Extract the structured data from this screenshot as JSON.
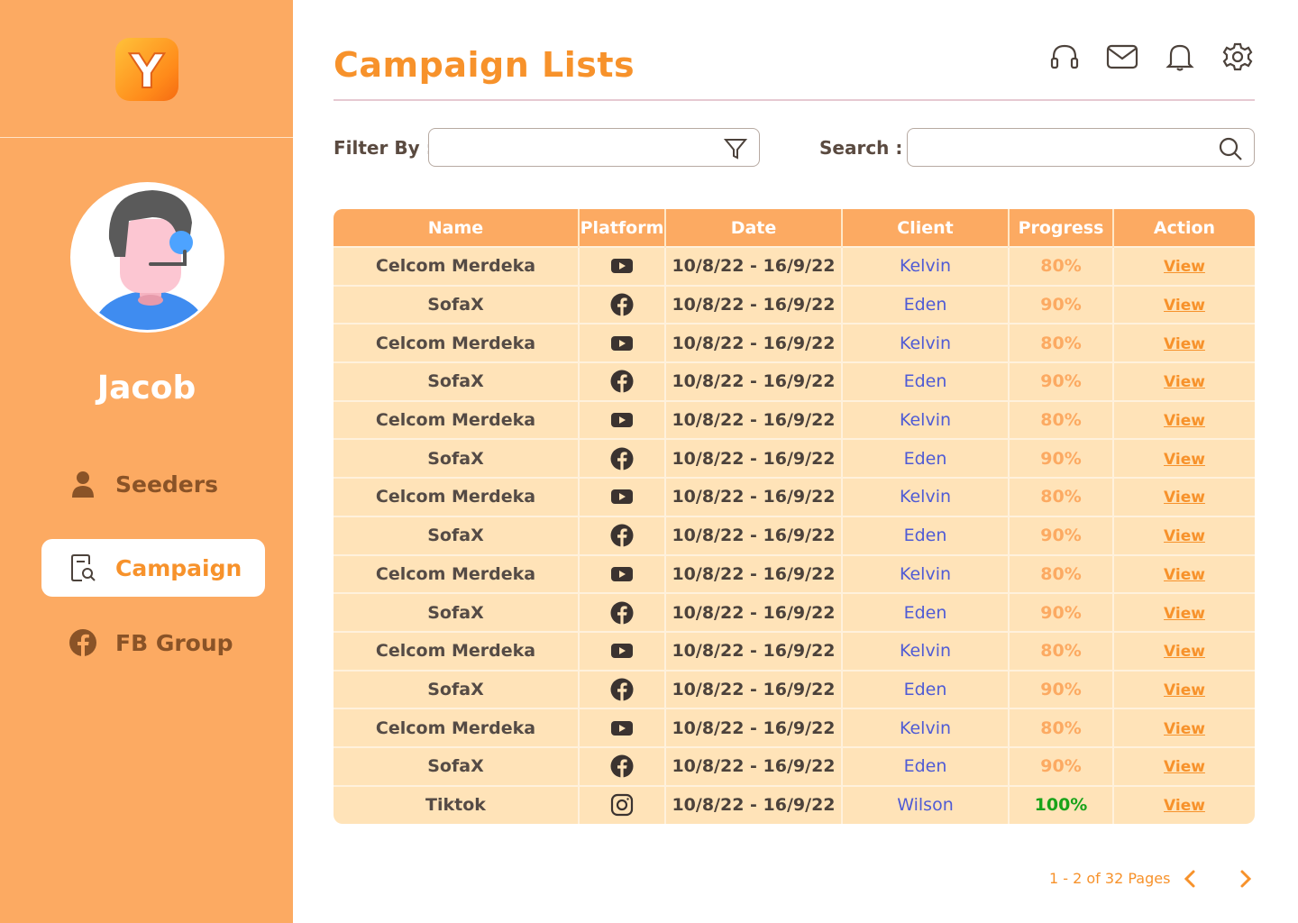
{
  "app": {
    "logo_letter": "Y",
    "accent_color": "#F7922B",
    "sidebar_color": "#FCAA62"
  },
  "sidebar": {
    "user_name": "Jacob",
    "items": [
      {
        "label": "Seeders",
        "icon": "user-icon",
        "active": false
      },
      {
        "label": "Campaign",
        "icon": "campaign-search-icon",
        "active": true
      },
      {
        "label": "FB Group",
        "icon": "facebook-icon",
        "active": false
      }
    ]
  },
  "header": {
    "title": "Campaign Lists",
    "icons": [
      "headset-icon",
      "mail-icon",
      "bell-icon",
      "gear-icon"
    ]
  },
  "filters": {
    "filter_label": "Filter By :",
    "filter_value": "",
    "search_label": "Search :",
    "search_value": ""
  },
  "table": {
    "columns": [
      "Name",
      "Platform",
      "Date",
      "Client",
      "Progress",
      "Action"
    ],
    "rows": [
      {
        "name": "Celcom Merdeka",
        "platform": "youtube-icon",
        "date": "10/8/22 - 16/9/22",
        "client": "Kelvin",
        "progress": "80%",
        "action": "View"
      },
      {
        "name": "SofaX",
        "platform": "facebook-icon",
        "date": "10/8/22 - 16/9/22",
        "client": "Eden",
        "progress": "90%",
        "action": "View"
      },
      {
        "name": "Celcom Merdeka",
        "platform": "youtube-icon",
        "date": "10/8/22 - 16/9/22",
        "client": "Kelvin",
        "progress": "80%",
        "action": "View"
      },
      {
        "name": "SofaX",
        "platform": "facebook-icon",
        "date": "10/8/22 - 16/9/22",
        "client": "Eden",
        "progress": "90%",
        "action": "View"
      },
      {
        "name": "Celcom Merdeka",
        "platform": "youtube-icon",
        "date": "10/8/22 - 16/9/22",
        "client": "Kelvin",
        "progress": "80%",
        "action": "View"
      },
      {
        "name": "SofaX",
        "platform": "facebook-icon",
        "date": "10/8/22 - 16/9/22",
        "client": "Eden",
        "progress": "90%",
        "action": "View"
      },
      {
        "name": "Celcom Merdeka",
        "platform": "youtube-icon",
        "date": "10/8/22 - 16/9/22",
        "client": "Kelvin",
        "progress": "80%",
        "action": "View"
      },
      {
        "name": "SofaX",
        "platform": "facebook-icon",
        "date": "10/8/22 - 16/9/22",
        "client": "Eden",
        "progress": "90%",
        "action": "View"
      },
      {
        "name": "Celcom Merdeka",
        "platform": "youtube-icon",
        "date": "10/8/22 - 16/9/22",
        "client": "Kelvin",
        "progress": "80%",
        "action": "View"
      },
      {
        "name": "SofaX",
        "platform": "facebook-icon",
        "date": "10/8/22 - 16/9/22",
        "client": "Eden",
        "progress": "90%",
        "action": "View"
      },
      {
        "name": "Celcom Merdeka",
        "platform": "youtube-icon",
        "date": "10/8/22 - 16/9/22",
        "client": "Kelvin",
        "progress": "80%",
        "action": "View"
      },
      {
        "name": "SofaX",
        "platform": "facebook-icon",
        "date": "10/8/22 - 16/9/22",
        "client": "Eden",
        "progress": "90%",
        "action": "View"
      },
      {
        "name": "Celcom Merdeka",
        "platform": "youtube-icon",
        "date": "10/8/22 - 16/9/22",
        "client": "Kelvin",
        "progress": "80%",
        "action": "View"
      },
      {
        "name": "SofaX",
        "platform": "facebook-icon",
        "date": "10/8/22 - 16/9/22",
        "client": "Eden",
        "progress": "90%",
        "action": "View"
      },
      {
        "name": "Tiktok",
        "platform": "instagram-icon",
        "date": "10/8/22 - 16/9/22",
        "client": "Wilson",
        "progress": "100%",
        "action": "View"
      }
    ]
  },
  "pagination": {
    "text": "1 - 2 of 32 Pages",
    "prev_icon": "chevron-left-icon",
    "next_icon": "chevron-right-icon"
  }
}
